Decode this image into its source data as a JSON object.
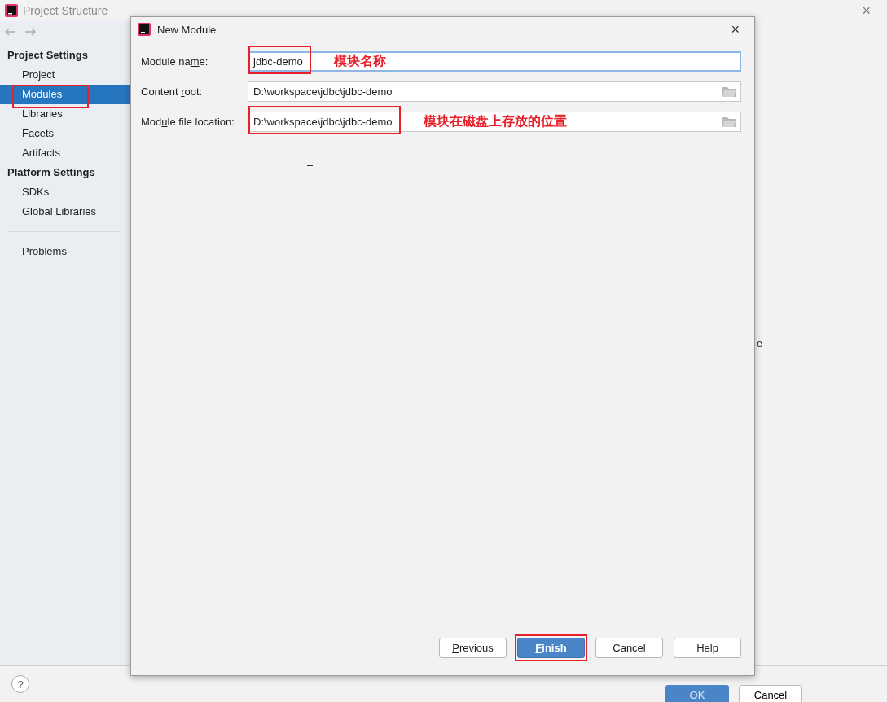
{
  "window": {
    "title": "Project Structure",
    "close": "×"
  },
  "sidebar": {
    "sections": [
      {
        "heading": "Project Settings",
        "items": [
          {
            "label": "Project",
            "selected": false,
            "highlighted": false
          },
          {
            "label": "Modules",
            "selected": true,
            "highlighted": true
          },
          {
            "label": "Libraries",
            "selected": false,
            "highlighted": false
          },
          {
            "label": "Facets",
            "selected": false,
            "highlighted": false
          },
          {
            "label": "Artifacts",
            "selected": false,
            "highlighted": false
          }
        ]
      },
      {
        "heading": "Platform Settings",
        "items": [
          {
            "label": "SDKs",
            "selected": false,
            "highlighted": false
          },
          {
            "label": "Global Libraries",
            "selected": false,
            "highlighted": false
          }
        ]
      }
    ],
    "footer_items": [
      {
        "label": "Problems",
        "selected": false,
        "highlighted": false
      }
    ]
  },
  "main": {
    "fragment": "e"
  },
  "bottom_bar": {
    "help": "?",
    "ok": "OK",
    "cancel": "Cancel"
  },
  "dialog": {
    "title": "New Module",
    "close": "×",
    "fields": [
      {
        "before": "Module na",
        "mnemonic": "m",
        "after": "e:",
        "value": "jdbc-demo",
        "focused": true,
        "browse": false,
        "highlighted": true,
        "note": "模块名称"
      },
      {
        "before": "Content ",
        "mnemonic": "r",
        "after": "oot:",
        "value": "D:\\workspace\\jdbc\\jdbc-demo",
        "focused": false,
        "browse": true,
        "highlighted": false
      },
      {
        "before": "Mod",
        "mnemonic": "u",
        "after": "le file location:",
        "value": "D:\\workspace\\jdbc\\jdbc-demo",
        "focused": false,
        "browse": true,
        "highlighted": true,
        "note": "模块在磁盘上存放的位置"
      }
    ],
    "buttons": [
      {
        "mnemonic": "P",
        "after": "revious",
        "default": false,
        "highlighted": false
      },
      {
        "mnemonic": "F",
        "after": "inish",
        "default": true,
        "highlighted": true
      },
      {
        "before": "Cancel",
        "default": false,
        "highlighted": false
      },
      {
        "before": "Help",
        "default": false,
        "highlighted": false
      }
    ]
  }
}
